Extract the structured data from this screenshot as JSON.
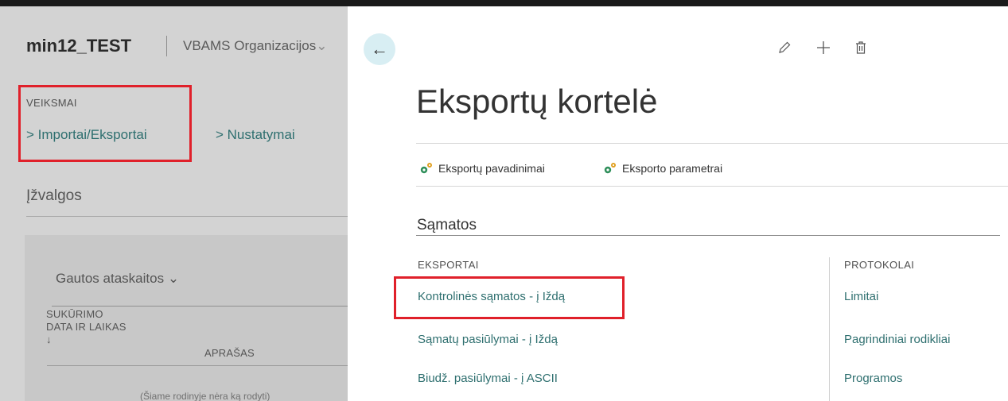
{
  "colors": {
    "highlight": "#e0202a",
    "link": "#2e6f6f",
    "back_button_bg": "#d8eef3"
  },
  "bg_page": {
    "company": "min12_TEST",
    "organization": "VBAMS Organizacijos",
    "organization_chevron_icon": "chevron-down-icon",
    "actions_header": "VEIKSMAI",
    "actions": [
      {
        "label": "> Importai/Eksportai"
      },
      {
        "label": "> Nustatymai"
      }
    ],
    "insights_title": "Įžvalgos",
    "part": {
      "title": "Gautos ataskaitos",
      "title_chevron_icon": "chevron-down-icon",
      "col1_header": "SUKŪRIMO\nDATA IR LAIKAS\n↓",
      "col2_header": "APRAŠAS",
      "empty_message": "(Šiame rodinyje nėra ką rodyti)"
    }
  },
  "card": {
    "toolbar": {
      "back_icon": "arrow-left-icon",
      "back_glyph": "←",
      "edit_icon": "pencil-icon",
      "new_icon": "plus-icon",
      "delete_icon": "trash-icon"
    },
    "title": "Eksportų kortelė",
    "actions": [
      {
        "label": "Eksportų pavadinimai",
        "icon": "gears-icon"
      },
      {
        "label": "Eksporto parametrai",
        "icon": "gears-icon"
      }
    ],
    "section_title": "Sąmatos",
    "groups": [
      {
        "header": "EKSPORTAI",
        "items": [
          "Kontrolinės sąmatos - į Iždą",
          "Sąmatų pasiūlymai - į Iždą",
          "Biudž. pasiūlymai - į ASCII"
        ]
      },
      {
        "header": "PROTOKOLAI",
        "items": [
          "Limitai",
          "Pagrindiniai rodikliai",
          "Programos"
        ]
      }
    ]
  }
}
